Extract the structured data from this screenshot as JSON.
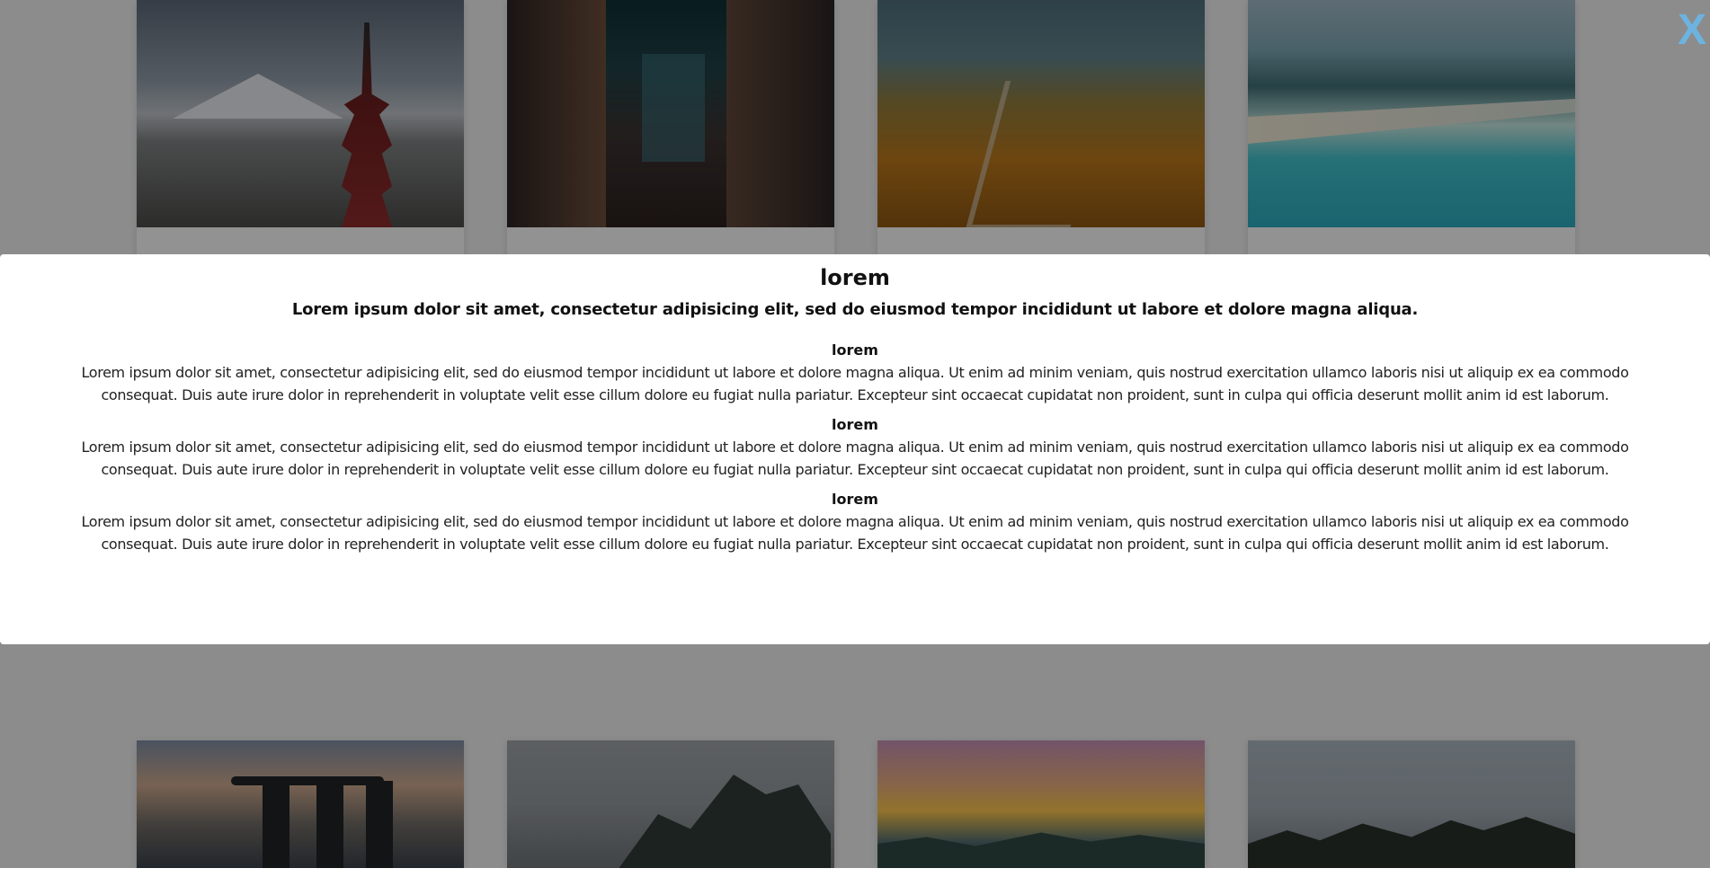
{
  "close_label": "X",
  "modal": {
    "title": "lorem",
    "lead": "Lorem ipsum dolor sit amet, consectetur adipisicing elit, sed do eiusmod tempor incididunt ut labore et dolore magna aliqua.",
    "sections": [
      {
        "heading": "lorem",
        "body": "Lorem ipsum dolor sit amet, consectetur adipisicing elit, sed do eiusmod tempor incididunt ut labore et dolore magna aliqua. Ut enim ad minim veniam, quis nostrud exercitation ullamco laboris nisi ut aliquip ex ea commodo consequat. Duis aute irure dolor in reprehenderit in voluptate velit esse cillum dolore eu fugiat nulla pariatur. Excepteur sint occaecat cupidatat non proident, sunt in culpa qui officia deserunt mollit anim id est laborum."
      },
      {
        "heading": "lorem",
        "body": "Lorem ipsum dolor sit amet, consectetur adipisicing elit, sed do eiusmod tempor incididunt ut labore et dolore magna aliqua. Ut enim ad minim veniam, quis nostrud exercitation ullamco laboris nisi ut aliquip ex ea commodo consequat. Duis aute irure dolor in reprehenderit in voluptate velit esse cillum dolore eu fugiat nulla pariatur. Excepteur sint occaecat cupidatat non proident, sunt in culpa qui officia deserunt mollit anim id est laborum."
      },
      {
        "heading": "lorem",
        "body": "Lorem ipsum dolor sit amet, consectetur adipisicing elit, sed do eiusmod tempor incididunt ut labore et dolore magna aliqua. Ut enim ad minim veniam, quis nostrud exercitation ullamco laboris nisi ut aliquip ex ea commodo consequat. Duis aute irure dolor in reprehenderit in voluptate velit esse cillum dolore eu fugiat nulla pariatur. Excepteur sint occaecat cupidatat non proident, sunt in culpa qui officia deserunt mollit anim id est laborum."
      }
    ]
  },
  "gallery": {
    "top_row": [
      "mount-fuji-pagoda-photo",
      "neon-city-street-photo",
      "great-wall-autumn-photo",
      "tropical-beach-resort-photo"
    ],
    "bottom_row": [
      "marina-bay-skyline-photo",
      "rocky-mountain-photo",
      "sunset-mountains-photo",
      "karst-peaks-photo"
    ]
  },
  "colors": {
    "overlay": "rgba(0,0,0,0.40)",
    "close_accent": "#6db3e0",
    "modal_bg": "#ffffff"
  }
}
